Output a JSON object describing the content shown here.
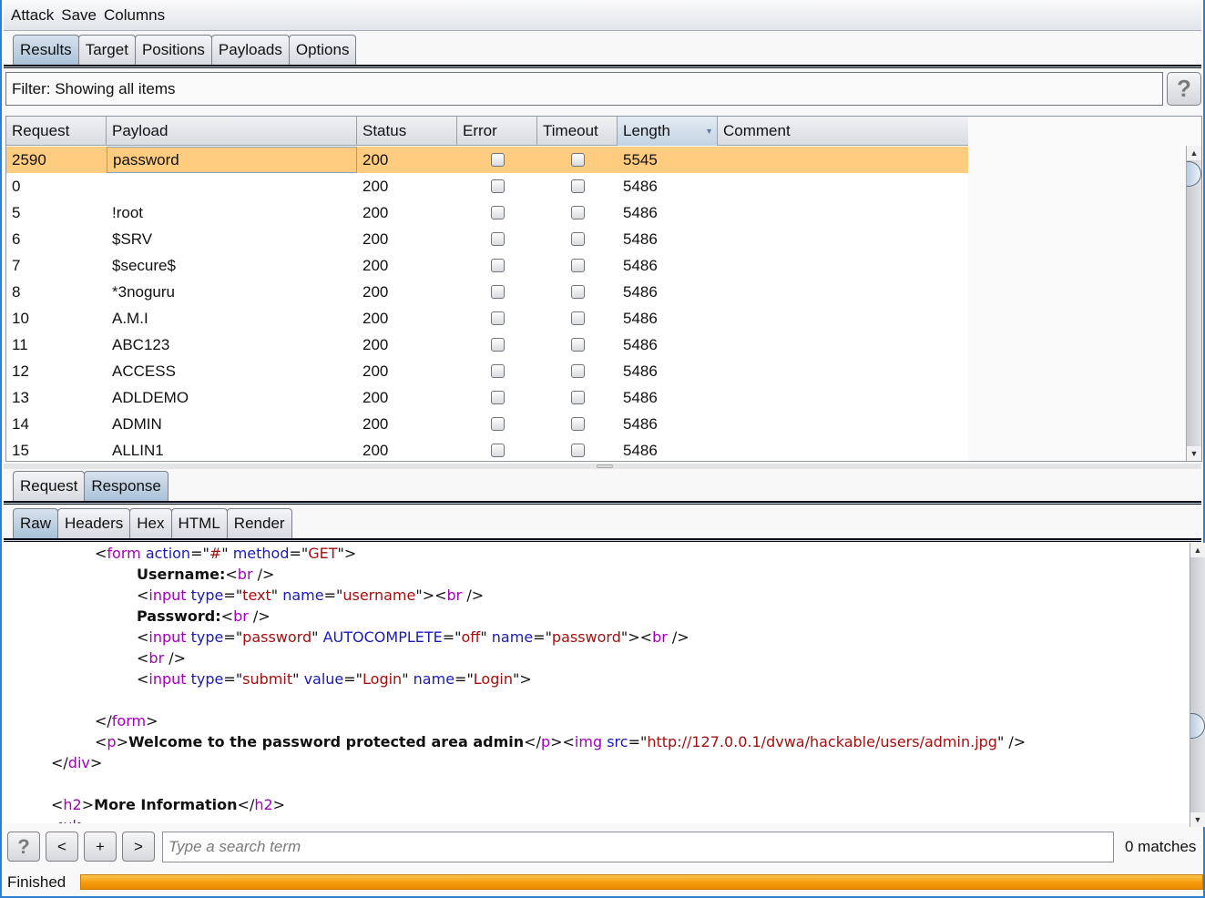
{
  "menu": [
    "Attack",
    "Save",
    "Columns"
  ],
  "main_tabs": [
    {
      "label": "Results",
      "active": true
    },
    {
      "label": "Target",
      "active": false
    },
    {
      "label": "Positions",
      "active": false
    },
    {
      "label": "Payloads",
      "active": false
    },
    {
      "label": "Options",
      "active": false
    }
  ],
  "filter": {
    "text": "Filter: Showing all items",
    "help_label": "?"
  },
  "table": {
    "columns": [
      "Request",
      "Payload",
      "Status",
      "Error",
      "Timeout",
      "Length",
      "Comment"
    ],
    "sorted_column": "Length",
    "rows": [
      {
        "request": "2590",
        "payload": "password",
        "status": "200",
        "error": false,
        "timeout": false,
        "length": "5545",
        "comment": "",
        "selected": true
      },
      {
        "request": "0",
        "payload": "",
        "status": "200",
        "error": false,
        "timeout": false,
        "length": "5486",
        "comment": ""
      },
      {
        "request": "5",
        "payload": "!root",
        "status": "200",
        "error": false,
        "timeout": false,
        "length": "5486",
        "comment": ""
      },
      {
        "request": "6",
        "payload": "$SRV",
        "status": "200",
        "error": false,
        "timeout": false,
        "length": "5486",
        "comment": ""
      },
      {
        "request": "7",
        "payload": "$secure$",
        "status": "200",
        "error": false,
        "timeout": false,
        "length": "5486",
        "comment": ""
      },
      {
        "request": "8",
        "payload": "*3noguru",
        "status": "200",
        "error": false,
        "timeout": false,
        "length": "5486",
        "comment": ""
      },
      {
        "request": "10",
        "payload": "A.M.I",
        "status": "200",
        "error": false,
        "timeout": false,
        "length": "5486",
        "comment": ""
      },
      {
        "request": "11",
        "payload": "ABC123",
        "status": "200",
        "error": false,
        "timeout": false,
        "length": "5486",
        "comment": ""
      },
      {
        "request": "12",
        "payload": "ACCESS",
        "status": "200",
        "error": false,
        "timeout": false,
        "length": "5486",
        "comment": ""
      },
      {
        "request": "13",
        "payload": "ADLDEMO",
        "status": "200",
        "error": false,
        "timeout": false,
        "length": "5486",
        "comment": ""
      },
      {
        "request": "14",
        "payload": "ADMIN",
        "status": "200",
        "error": false,
        "timeout": false,
        "length": "5486",
        "comment": ""
      },
      {
        "request": "15",
        "payload": "ALLIN1",
        "status": "200",
        "error": false,
        "timeout": false,
        "length": "5486",
        "comment": ""
      }
    ]
  },
  "detail_tabs": [
    {
      "label": "Request",
      "active": false
    },
    {
      "label": "Response",
      "active": true
    }
  ],
  "view_tabs": [
    {
      "label": "Raw",
      "active": true
    },
    {
      "label": "Headers",
      "active": false
    },
    {
      "label": "Hex",
      "active": false
    },
    {
      "label": "HTML",
      "active": false
    },
    {
      "label": "Render",
      "active": false
    }
  ],
  "response_lines": [
    {
      "indent": 2,
      "tokens": [
        [
          "p",
          "<"
        ],
        [
          "t",
          "form"
        ],
        [
          "p",
          " "
        ],
        [
          "a",
          "action"
        ],
        [
          "p",
          "=\""
        ],
        [
          "v",
          "#"
        ],
        [
          "p",
          "\" "
        ],
        [
          "a",
          "method"
        ],
        [
          "p",
          "=\""
        ],
        [
          "v",
          "GET"
        ],
        [
          "p",
          "\">"
        ]
      ]
    },
    {
      "indent": 3,
      "tokens": [
        [
          "b",
          "Username:"
        ],
        [
          "p",
          "<"
        ],
        [
          "t",
          "br"
        ],
        [
          "p",
          " />"
        ]
      ]
    },
    {
      "indent": 3,
      "tokens": [
        [
          "p",
          "<"
        ],
        [
          "t",
          "input"
        ],
        [
          "p",
          " "
        ],
        [
          "a",
          "type"
        ],
        [
          "p",
          "=\""
        ],
        [
          "v",
          "text"
        ],
        [
          "p",
          "\" "
        ],
        [
          "a",
          "name"
        ],
        [
          "p",
          "=\""
        ],
        [
          "v",
          "username"
        ],
        [
          "p",
          "\"><"
        ],
        [
          "t",
          "br"
        ],
        [
          "p",
          " />"
        ]
      ]
    },
    {
      "indent": 3,
      "tokens": [
        [
          "b",
          "Password:"
        ],
        [
          "p",
          "<"
        ],
        [
          "t",
          "br"
        ],
        [
          "p",
          " />"
        ]
      ]
    },
    {
      "indent": 3,
      "tokens": [
        [
          "p",
          "<"
        ],
        [
          "t",
          "input"
        ],
        [
          "p",
          " "
        ],
        [
          "a",
          "type"
        ],
        [
          "p",
          "=\""
        ],
        [
          "v",
          "password"
        ],
        [
          "p",
          "\" "
        ],
        [
          "a",
          "AUTOCOMPLETE"
        ],
        [
          "p",
          "=\""
        ],
        [
          "v",
          "off"
        ],
        [
          "p",
          "\" "
        ],
        [
          "a",
          "name"
        ],
        [
          "p",
          "=\""
        ],
        [
          "v",
          "password"
        ],
        [
          "p",
          "\"><"
        ],
        [
          "t",
          "br"
        ],
        [
          "p",
          " />"
        ]
      ]
    },
    {
      "indent": 3,
      "tokens": [
        [
          "p",
          "<"
        ],
        [
          "t",
          "br"
        ],
        [
          "p",
          " />"
        ]
      ]
    },
    {
      "indent": 3,
      "tokens": [
        [
          "p",
          "<"
        ],
        [
          "t",
          "input"
        ],
        [
          "p",
          " "
        ],
        [
          "a",
          "type"
        ],
        [
          "p",
          "=\""
        ],
        [
          "v",
          "submit"
        ],
        [
          "p",
          "\" "
        ],
        [
          "a",
          "value"
        ],
        [
          "p",
          "=\""
        ],
        [
          "v",
          "Login"
        ],
        [
          "p",
          "\" "
        ],
        [
          "a",
          "name"
        ],
        [
          "p",
          "=\""
        ],
        [
          "v",
          "Login"
        ],
        [
          "p",
          "\">"
        ]
      ]
    },
    {
      "indent": 0,
      "tokens": []
    },
    {
      "indent": 2,
      "tokens": [
        [
          "p",
          "</"
        ],
        [
          "t",
          "form"
        ],
        [
          "p",
          ">"
        ]
      ]
    },
    {
      "indent": 2,
      "tokens": [
        [
          "p",
          "<"
        ],
        [
          "t",
          "p"
        ],
        [
          "p",
          ">"
        ],
        [
          "b",
          "Welcome to the password protected area admin"
        ],
        [
          "p",
          "</"
        ],
        [
          "t",
          "p"
        ],
        [
          "p",
          "><"
        ],
        [
          "t",
          "img"
        ],
        [
          "p",
          " "
        ],
        [
          "a",
          "src"
        ],
        [
          "p",
          "=\""
        ],
        [
          "v",
          "http://127.0.0.1/dvwa/hackable/users/admin.jpg"
        ],
        [
          "p",
          "\" />"
        ]
      ]
    },
    {
      "indent": 1,
      "tokens": [
        [
          "p",
          "</"
        ],
        [
          "t",
          "div"
        ],
        [
          "p",
          ">"
        ]
      ]
    },
    {
      "indent": 0,
      "tokens": []
    },
    {
      "indent": 1,
      "tokens": [
        [
          "p",
          "<"
        ],
        [
          "t",
          "h2"
        ],
        [
          "p",
          ">"
        ],
        [
          "b",
          "More Information"
        ],
        [
          "p",
          "</"
        ],
        [
          "t",
          "h2"
        ],
        [
          "p",
          ">"
        ]
      ]
    },
    {
      "indent": 1,
      "tokens": [
        [
          "p",
          "<"
        ],
        [
          "t",
          "ul"
        ],
        [
          "p",
          ">"
        ]
      ]
    }
  ],
  "search": {
    "help_label": "?",
    "prev_label": "<",
    "add_label": "+",
    "next_label": ">",
    "placeholder": "Type a search term",
    "matches": "0 matches"
  },
  "status": {
    "label": "Finished",
    "progress_percent": 100
  },
  "colors": {
    "selected_row": "#ffcc80",
    "progress": "#f59a0a",
    "accent_border": "#2d7fd0"
  }
}
